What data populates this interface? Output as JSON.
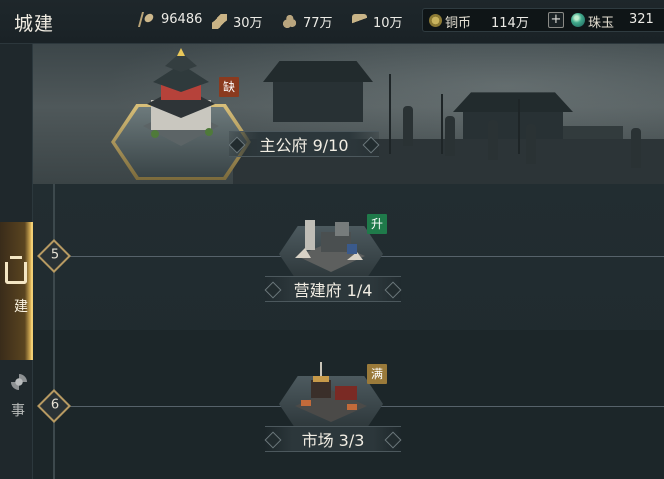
{
  "header": {
    "title": "城建",
    "resources": [
      {
        "icon": "grain-icon",
        "value": "96486"
      },
      {
        "icon": "wood-icon",
        "value": "30万"
      },
      {
        "icon": "stone-icon",
        "value": "77万"
      },
      {
        "icon": "iron-icon",
        "value": "10万"
      }
    ],
    "copper": {
      "icon": "copper-coin-icon",
      "label": "铜币",
      "value": "114万"
    },
    "add_label": "+",
    "jade": {
      "icon": "jade-icon",
      "label": "珠玉",
      "value": "321"
    }
  },
  "sidebar": {
    "tabs": [
      {
        "label": "建",
        "icon": "city-build-icon",
        "active": true
      },
      {
        "label": "事",
        "icon": "military-affairs-icon",
        "active": false
      }
    ]
  },
  "buildings": {
    "main_hall": {
      "name": "主公府 9/10",
      "badge": "缺",
      "badge_color": "#8b3a1e"
    },
    "tiers": [
      {
        "level": "5",
        "building": {
          "name": "营建府 1/4",
          "badge": "升",
          "badge_color": "#1f7a4a"
        }
      },
      {
        "level": "6",
        "building": {
          "name": "市场 3/3",
          "badge": "满",
          "badge_color": "#9a7a3a"
        }
      }
    ]
  },
  "colors": {
    "accent_gold": "#e2b85a",
    "background": "#1b2428"
  }
}
